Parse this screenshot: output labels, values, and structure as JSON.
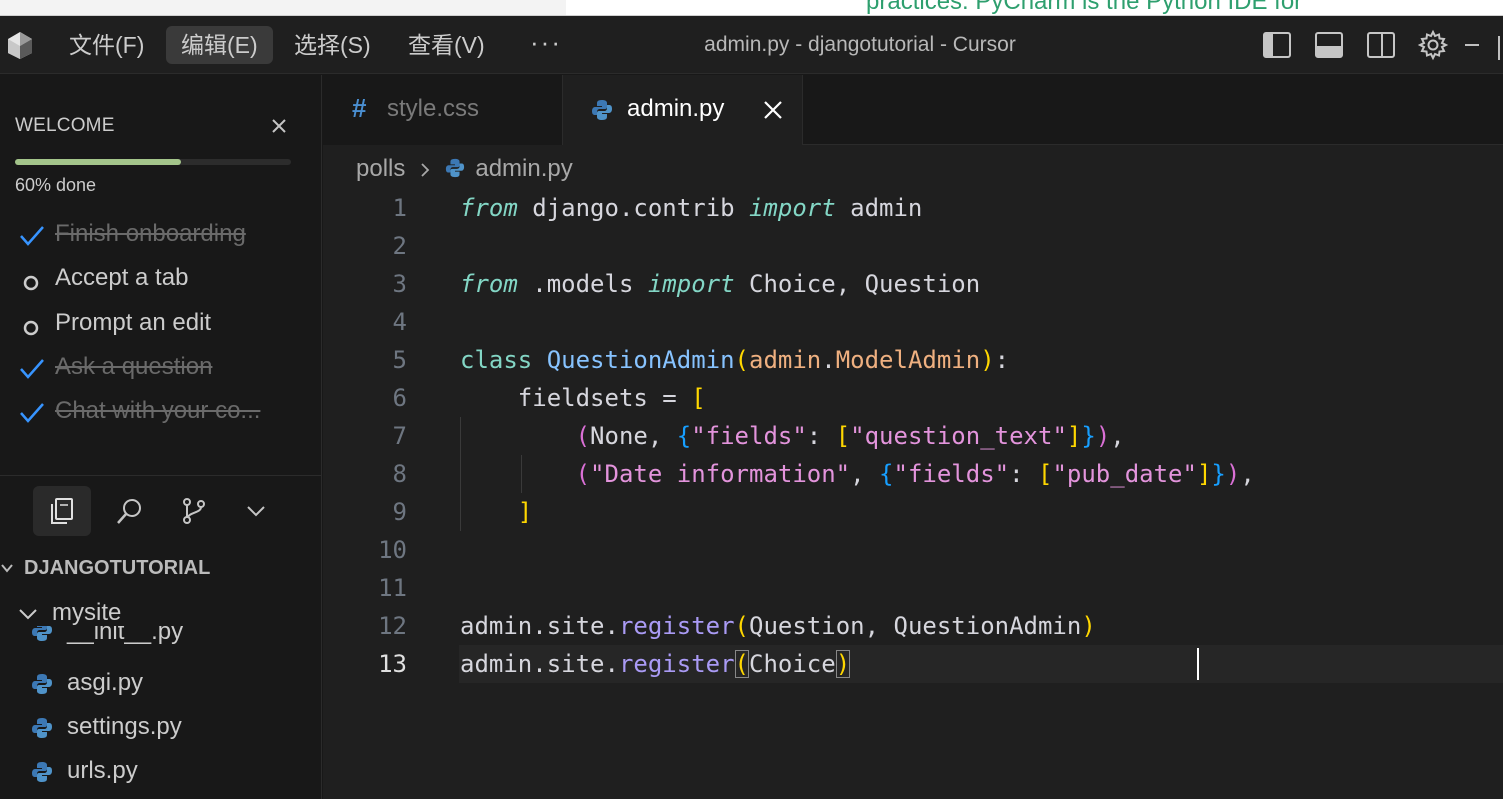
{
  "browser_peek": {
    "text": "practices. PyCharm is the Python IDE for"
  },
  "menu": [
    {
      "label": "文件(F)"
    },
    {
      "label": "编辑(E)",
      "active": true
    },
    {
      "label": "选择(S)"
    },
    {
      "label": "查看(V)"
    }
  ],
  "menu_more": "···",
  "window_title": "admin.py - djangotutorial - Cursor",
  "welcome": {
    "title": "WELCOME",
    "progress_percent": 60,
    "progress_text": "60% done",
    "tasks": [
      {
        "label": "Finish onboarding",
        "done": true
      },
      {
        "label": "Accept a tab",
        "done": false
      },
      {
        "label": "Prompt an edit",
        "done": false
      },
      {
        "label": "Ask a question",
        "done": true
      },
      {
        "label": "Chat with your co...",
        "done": true
      }
    ]
  },
  "explorer": {
    "title": "DJANGOTUTORIAL",
    "folder": "mysite",
    "files": [
      "__init__.py",
      "asgi.py",
      "settings.py",
      "urls.py"
    ]
  },
  "tabs": [
    {
      "label": "style.css",
      "icon": "css-hash-icon",
      "active": false
    },
    {
      "label": "admin.py",
      "icon": "python-icon",
      "active": true
    }
  ],
  "breadcrumb": {
    "folder": "polls",
    "file": "admin.py"
  },
  "code": {
    "current_line": 13,
    "line_numbers": [
      "1",
      "2",
      "3",
      "4",
      "5",
      "6",
      "7",
      "8",
      "9",
      "10",
      "11",
      "12",
      "13"
    ]
  },
  "colors": {
    "accent_progress": "#a3c48a",
    "check_blue": "#3794ff",
    "keyword": "#83d6c5",
    "string": "#e394dc",
    "function": "#aa9bf5"
  }
}
